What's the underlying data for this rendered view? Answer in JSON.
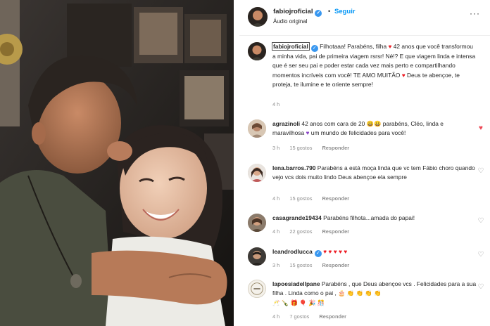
{
  "post": {
    "username": "fabiojroficial",
    "follow_label": "Seguir",
    "audio_label": "Áudio original",
    "dot": "•",
    "more": "···"
  },
  "caption": {
    "username": "fabiojroficial",
    "text_1": "Filhotaaa! Parabéns, filha",
    "heart": "♥",
    "text_2": "42 anos que você transformou a minha vida, pai de primeira viagem rsrsr! Né!? E que viagem linda e intensa que é ser seu pai e poder estar cada vez mais perto e compartilhando momentos incríveis com você! TE AMO MUITÃO",
    "text_3": "Deus te abençoe, te proteja, te ilumine e te oriente sempre!",
    "time": "4 h"
  },
  "comments": [
    {
      "username": "agrazinoli",
      "text_a": "42 anos com cara de 20",
      "emoji_a": "😀😀",
      "text_b": "parabéns, Cléo, linda e maravilhosa",
      "emoji_b": "♥",
      "text_c": "um mundo de felicidades para você!",
      "time": "3 h",
      "likes": "15 gostos",
      "reply": "Responder",
      "liked": true
    },
    {
      "username": "lena.barros.790",
      "text": "Parabéns a está moça linda que vc tem Fábio choro quando vejo vcs dois muito lindo Deus abençoe ela sempre",
      "time": "4 h",
      "likes": "15 gostos",
      "reply": "Responder",
      "liked": false
    },
    {
      "username": "casagrande19434",
      "text": "Parabéns filhota...amada do papai!",
      "time": "4 h",
      "likes": "22 gostos",
      "reply": "Responder",
      "liked": false
    },
    {
      "username": "leandrodlucca",
      "text": "♥ ♥ ♥ ♥ ♥",
      "time": "3 h",
      "likes": "15 gostos",
      "reply": "Responder",
      "liked": false
    },
    {
      "username": "lapoesiadellpane",
      "text": "Parabéns , que Deus abençoe vcs . Felicidades para a sua filha . Linda como o pai ,",
      "emoji_line": "🎂 👏 👏 👏 👏",
      "emoji_line2": "🥂 🍾 🎁 🎈 🎉 🎊",
      "time": "4 h",
      "likes": "7 gostos",
      "reply": "Responder",
      "liked": false
    }
  ],
  "icons": {
    "heart_filled": "♥",
    "heart_outline": "♡",
    "check": "✓"
  },
  "colors": {
    "accent": "#0095f6",
    "verified": "#3897f0",
    "like": "#ed4956",
    "meta": "#8e8e8e"
  }
}
